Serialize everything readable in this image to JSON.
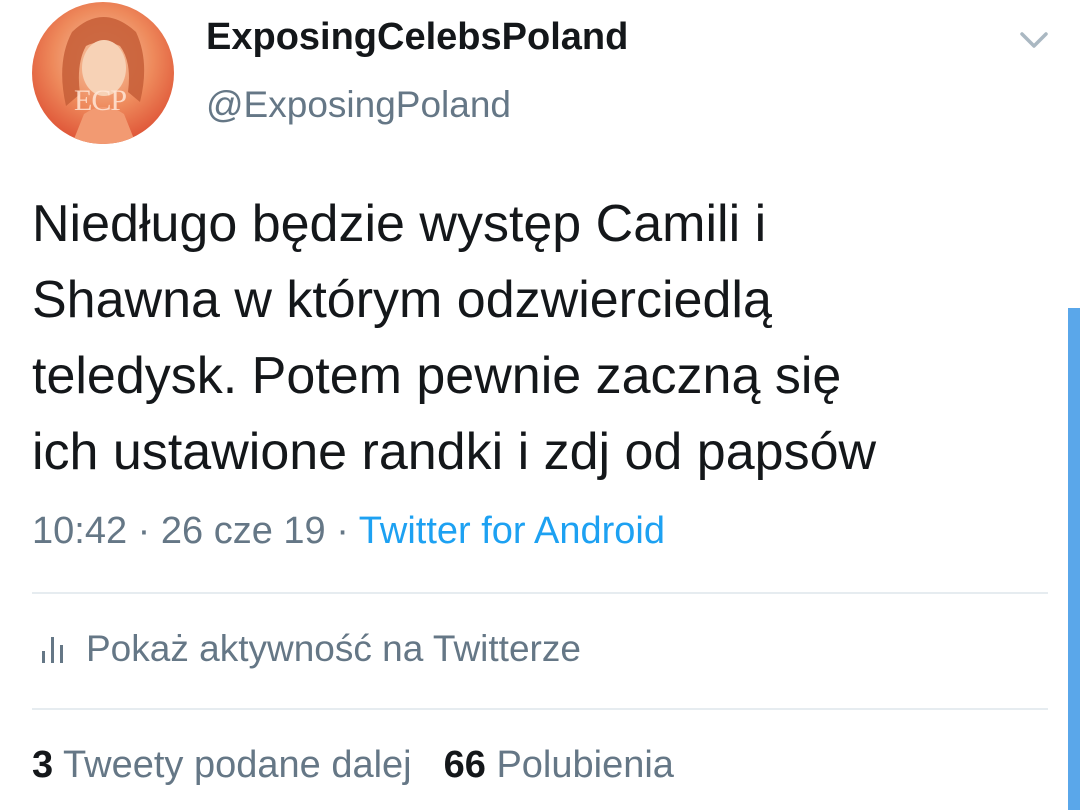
{
  "colors": {
    "link": "#1da1f2",
    "secondary_text": "#657786",
    "primary_text": "#14171a",
    "divider": "#e6ecf0",
    "scrollbar": "#5aa7ea"
  },
  "author": {
    "avatar_icon": "profile-photo",
    "avatar_mark": "ECP",
    "display_name": "ExposingCelebsPoland",
    "handle": "@ExposingPoland",
    "menu_icon": "chevron-down-icon"
  },
  "tweet": {
    "text_lines": [
      "Niedługo będzie występ Camili i",
      "Shawna w którym odzwierciedlą",
      "teledysk. Potem pewnie zaczną się",
      "ich ustawione randki i zdj od papsów"
    ],
    "time": "10:42",
    "separator": "·",
    "date": "26 cze 19",
    "source": "Twitter for Android"
  },
  "activity": {
    "icon": "bar-chart-icon",
    "label": "Pokaż aktywność na Twitterze"
  },
  "stats": {
    "retweets_count": "3",
    "retweets_label": "Tweety podane dalej",
    "likes_count": "66",
    "likes_label": "Polubienia"
  }
}
